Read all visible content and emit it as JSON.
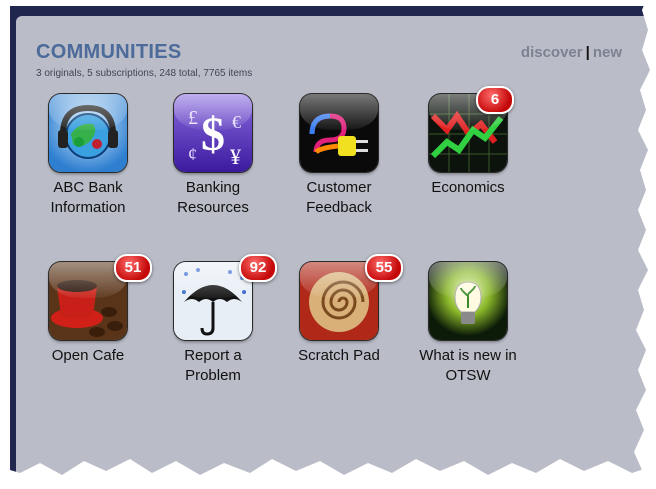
{
  "header": {
    "title": "COMMUNITIES",
    "subtitle": "3 originals, 5 subscriptions, 248 total, 7765 items",
    "discover_label": "discover",
    "separator": "|",
    "new_label": "new"
  },
  "communities": [
    {
      "label_line1": "ABC Bank",
      "label_line2": "Information",
      "badge": "",
      "icon": "globe-headset-icon"
    },
    {
      "label_line1": "Banking",
      "label_line2": "Resources",
      "badge": "",
      "icon": "currency-icon"
    },
    {
      "label_line1": "Customer",
      "label_line2": "Feedback",
      "badge": "",
      "icon": "plug-icon"
    },
    {
      "label_line1": "Economics",
      "label_line2": "",
      "badge": "6",
      "icon": "stock-chart-icon"
    },
    {
      "label_line1": "Open Cafe",
      "label_line2": "",
      "badge": "51",
      "icon": "coffee-cup-icon"
    },
    {
      "label_line1": "Report a",
      "label_line2": "Problem",
      "badge": "92",
      "icon": "umbrella-icon"
    },
    {
      "label_line1": "Scratch Pad",
      "label_line2": "",
      "badge": "55",
      "icon": "nautilus-shell-icon"
    },
    {
      "label_line1": "What is new in",
      "label_line2": "OTSW",
      "badge": "",
      "icon": "lightbulb-icon"
    }
  ],
  "colors": {
    "background": "#babdc8",
    "title": "#4c6a9a",
    "badge": "#c40808",
    "frame": "#20264d"
  }
}
